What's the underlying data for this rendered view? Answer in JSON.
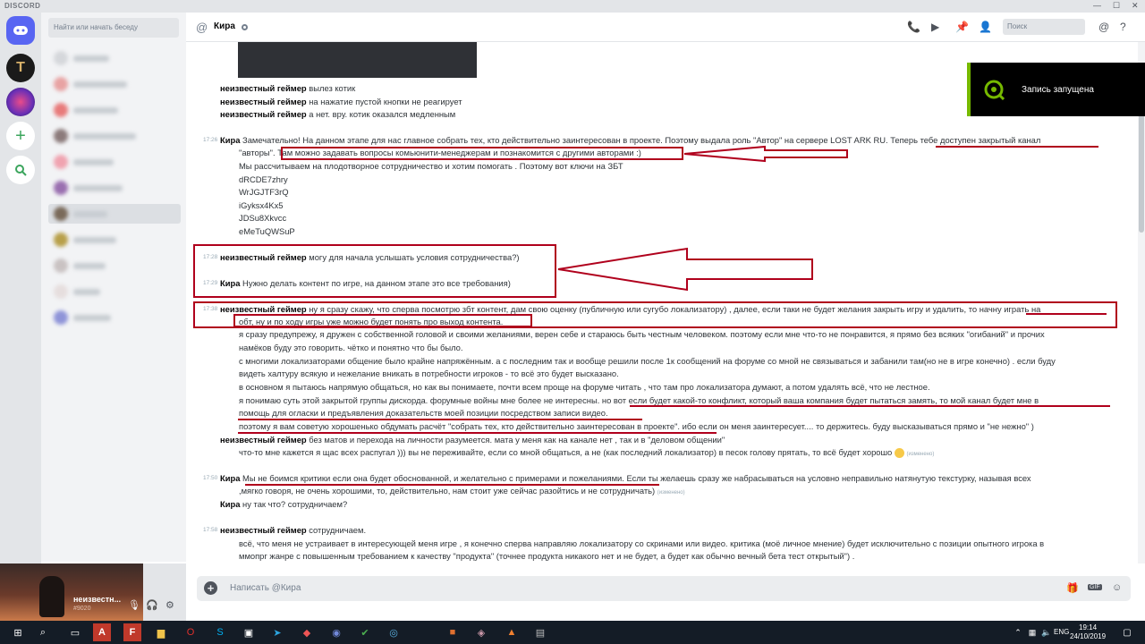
{
  "app": {
    "brand": "DISCORD"
  },
  "sidebar": {
    "search_placeholder": "Найти или начать беседу"
  },
  "header": {
    "title": "Кира",
    "search_placeholder": "Поиск"
  },
  "user": {
    "name": "неизвестн...",
    "tag": "#9020"
  },
  "recording": {
    "label": "Запись запущена"
  },
  "input": {
    "placeholder": "Написать @Кира"
  },
  "taskbar": {
    "lang": "ENG",
    "time": "19:14",
    "date": "24/10/2019"
  },
  "messages": {
    "m0l1": {
      "author": "неизвестный геймер",
      "text": "вылез котик"
    },
    "m0l2": {
      "author": "неизвестный геймер",
      "text": "на нажатие пустой кнопки не реагирует"
    },
    "m0l3": {
      "author": "неизвестный геймер",
      "text": "а нет. вру. котик оказался медленным"
    },
    "m1": {
      "time": "17:26",
      "author": "Кира",
      "text": "Замечательно! На данном этапе для нас главное собрать тех, кто действительно заинтересован в проекте. Поэтому выдала роль \"Автор\" на сервере LOST ARK RU. Теперь тебе доступен закрытый канал"
    },
    "m1c": "\"авторы\". Там можно задавать вопросы комьюнити-менеджерам и познакомится с другими авторами :)",
    "m1d": "Мы рассчитываем на плодотворное сотрудничество и хотим помогать . Поэтому вот ключи на ЗБТ",
    "keys": [
      "dRCDE7zhry",
      "WrJGJTF3rQ",
      "iGyksx4Kx5",
      "JDSu8Xkvcc",
      "eMeTuQWSuP"
    ],
    "m2": {
      "time": "17:28",
      "author": "неизвестный геймер",
      "text": "могу для начала услышать условия сотрудничества?)"
    },
    "m3": {
      "time": "17:29",
      "author": "Кира",
      "text": "Нужно делать контент по игре, на данном этапе это все требования)"
    },
    "m4": {
      "time": "17:38",
      "author": "неизвестный геймер",
      "text": "ну я сразу скажу, что сперва посмотрю збт контент,  дам свою оценку (публичную или сугубо локализатору) , далее, если таки не будет желания закрыть игру и удалить, то начну играть на"
    },
    "m4c": "обт, ну и по ходу игры уже можно будет понять про выход контента.",
    "m4d": "я сразу предупрежу, я дружен с собственной головой и своими желаниями, верен себе и стараюсь быть честным человеком. поэтому если мне что-то не понравится, я прямо без всяких \"огибаний\" и прочих",
    "m4e": "намёков буду это говорить. чётко и понятно что бы было.",
    "m4f": "с многими локализаторами общение было крайне напряжённым. а с последним так и вообще решили после 1к сообщений на форуме со мной не связываться и забанили там(но не в игре конечно)  . если буду",
    "m4g": "видеть халтуру всякую и нежелание вникать в потребности игроков - то всё это будет высказано.",
    "m4h": "в основном я пытаюсь напрямую общаться, но как вы понимаете, почти всем проще на форуме читать , что там про локализатора думают, а потом удалять всё, что не лестное.",
    "m4i": "я понимаю суть этой закрытой группы дискорда. форумные войны мне более не интересны. но вот если будет какой-то конфликт, который ваша компания будет пытаться замять, то мой канал будет мне в",
    "m4j": "помощь для огласки и предъявления доказательств моей позиции посредством записи видео.",
    "m4k": "поэтому я вам советую хорошенько обдумать расчёт \"собрать тех, кто действительно заинтересован в проекте\".   ибо если он меня заинтересует.... то держитесь. буду высказываться прямо и \"не нежно\" )",
    "m5": {
      "author": "неизвестный геймер",
      "text": "без матов и перехода на личности разумеется. мата у меня как на канале нет , так и в \"деловом общении\""
    },
    "m5b": "что-то мне кажется я щас всех распугал ))) вы не переживайте, если со мной общаться, а не (как последний локализатор)  в песок голову прятать, то всё будет хорошо",
    "edited": "(изменено)",
    "m6": {
      "time": "17:50",
      "author": "Кира",
      "text": "Мы не боимся критики если она будет обоснованной, и желательно с примерами и пожеланиями. Если ты желаешь сразу же набрасываться на условно неправильно натянутую текстурку, называя всех"
    },
    "m6b": ",мягко говоря, не очень хорошими, то, действительно, нам стоит уже сейчас разойтись и не сотрудничать)",
    "m7": {
      "author": "Кира",
      "text": "ну так что? сотрудничаем?"
    },
    "m8": {
      "time": "17:58",
      "author": "неизвестный геймер",
      "text": "сотрудничаем."
    },
    "m8b": "всё, что меня не устраивает в интересующей меня игре , я конечно сперва направляю локализатору со скринами или видео.  критика (моё личное мнение) будет исключительно с позиции опытного игрока в",
    "m8c": "ммопрг жанре с повышенным требованием к качеству \"продукта\" (точнее продукта никакого нет и не будет, а будет как обычно вечный бета тест открытый\") ."
  }
}
